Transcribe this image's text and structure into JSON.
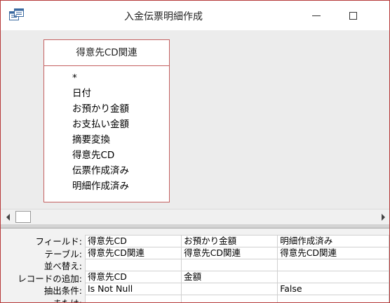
{
  "window": {
    "title": "入金伝票明細作成",
    "border_color": "#b63a3a"
  },
  "table": {
    "name": "得意先CD関連",
    "fields": [
      "*",
      "日付",
      "お預かり金額",
      "お支払い金額",
      "摘要変換",
      "得意先CD",
      "伝票作成済み",
      "明細作成済み"
    ]
  },
  "grid": {
    "row_labels": [
      "フィールド:",
      "テーブル:",
      "並べ替え:",
      "レコードの追加:",
      "抽出条件:",
      "または:"
    ],
    "columns": [
      {
        "field": "得意先CD",
        "table": "得意先CD関連",
        "sort": "",
        "append_to": "得意先CD",
        "criteria": "Is Not Null",
        "or": ""
      },
      {
        "field": "お預かり金額",
        "table": "得意先CD関連",
        "sort": "",
        "append_to": "金額",
        "criteria": "",
        "or": ""
      },
      {
        "field": "明細作成済み",
        "table": "得意先CD関連",
        "sort": "",
        "append_to": "",
        "criteria": "False",
        "or": ""
      }
    ]
  }
}
